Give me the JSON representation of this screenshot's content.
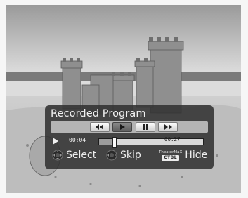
{
  "osd": {
    "title": "Recorded Program",
    "controls": [
      {
        "name": "rewind-button",
        "icon": "rewind-icon"
      },
      {
        "name": "play-button",
        "icon": "play-icon",
        "active": true
      },
      {
        "name": "pause-button",
        "icon": "pause-icon"
      },
      {
        "name": "fast-forward-button",
        "icon": "fast-forward-icon"
      }
    ],
    "playback": {
      "status_icon": "play-icon",
      "elapsed": "00:04",
      "total": "00:27",
      "progress_fraction": 0.15
    },
    "hints": {
      "select_label": "Select",
      "skip_label": "Skip",
      "hide_label": "Hide",
      "theater_brand": "TheaterMaX",
      "theater_key": "CTBL"
    }
  },
  "colors": {
    "panel_bg": "#323232",
    "control_bar": "#b4b4b4",
    "accent_active": "#6a6a6a"
  }
}
